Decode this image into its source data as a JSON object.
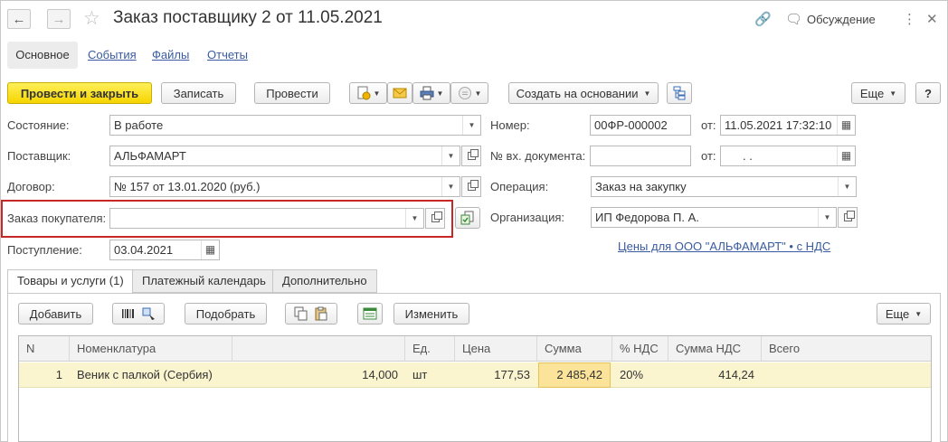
{
  "header": {
    "title": "Заказ поставщику 2  от 11.05.2021",
    "discuss_label": "Обсуждение"
  },
  "top_tabs": [
    "Основное",
    "События",
    "Файлы",
    "Отчеты"
  ],
  "toolbar": {
    "post_close": "Провести и закрыть",
    "save": "Записать",
    "post": "Провести",
    "create_based": "Создать на основании",
    "more": "Еще",
    "help": "?"
  },
  "form": {
    "state_label": "Состояние:",
    "state_value": "В работе",
    "supplier_label": "Поставщик:",
    "supplier_value": "АЛЬФАМАРТ",
    "contract_label": "Договор:",
    "contract_value": "№ 157 от 13.01.2020 (руб.)",
    "customer_order_label": "Заказ покупателя:",
    "customer_order_value": "",
    "arrival_label": "Поступление:",
    "arrival_value": "03.04.2021",
    "number_label": "Номер:",
    "number_value": "00ФР-000002",
    "from_label": "от:",
    "from_value": "11.05.2021 17:32:10",
    "incoming_doc_label": "№ вх. документа:",
    "incoming_doc_value": "",
    "from2_label": "от:",
    "from2_value": " .  .",
    "operation_label": "Операция:",
    "operation_value": "Заказ на закупку",
    "organization_label": "Организация:",
    "organization_value": "ИП Федорова П. А.",
    "prices_link": "Цены для ООО \"АЛЬФАМАРТ\" • с НДС"
  },
  "lower_tabs": [
    "Товары и услуги (1)",
    "Платежный календарь",
    "Дополнительно"
  ],
  "table_toolbar": {
    "add": "Добавить",
    "pick": "Подобрать",
    "change": "Изменить",
    "more": "Еще"
  },
  "table": {
    "columns": [
      "N",
      "Номенклатура",
      "",
      "Ед.",
      "Цена",
      "Сумма",
      "% НДС",
      "Сумма НДС",
      "Всего"
    ],
    "rows": [
      [
        "1",
        "Веник с палкой (Сербия)",
        "14,000",
        "шт",
        "177,53",
        "2 485,42",
        "20%",
        "414,24",
        ""
      ]
    ]
  },
  "colors": {
    "accent_yellow": "#f5d500",
    "highlight_red": "#c62828",
    "link_blue": "#3a5ba0",
    "row_selected": "#faf4cf"
  }
}
